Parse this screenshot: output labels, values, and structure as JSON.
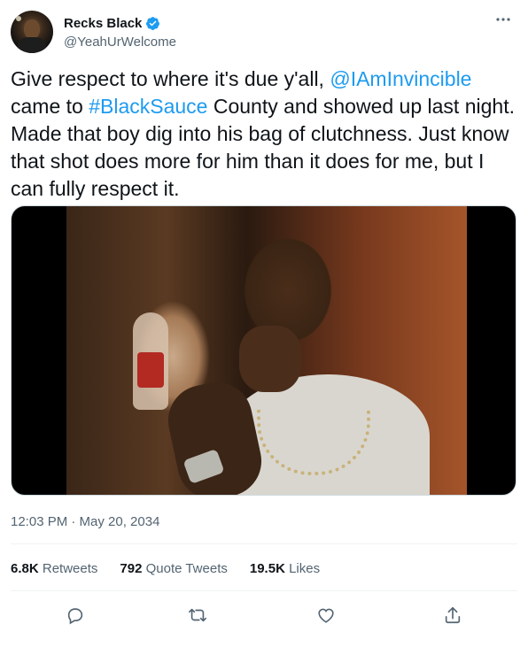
{
  "author": {
    "display_name": "Recks Black",
    "handle": "@YeahUrWelcome",
    "verified": true,
    "avatar_icon": "profile-photo"
  },
  "tweet": {
    "text_1": "Give respect to where it's due y'all, ",
    "mention": "@IAmInvincible",
    "text_2": " came to ",
    "hashtag": "#BlackSauce",
    "text_3": " County and showed up last night. Made that boy dig into his bag of clutchness. Just know that shot does more for him than it does for me, but I can fully respect it."
  },
  "meta": {
    "timestamp": "12:03 PM · May 20, 2034"
  },
  "stats": {
    "retweets_count": "6.8K",
    "retweets_label": "Retweets",
    "quotes_count": "792",
    "quotes_label": "Quote Tweets",
    "likes_count": "19.5K",
    "likes_label": "Likes"
  },
  "actions": [
    "reply-icon",
    "retweet-icon",
    "like-icon",
    "share-icon"
  ],
  "colors": {
    "accent": "#1d9bf0",
    "text": "#0f1419",
    "secondary": "#536471"
  }
}
